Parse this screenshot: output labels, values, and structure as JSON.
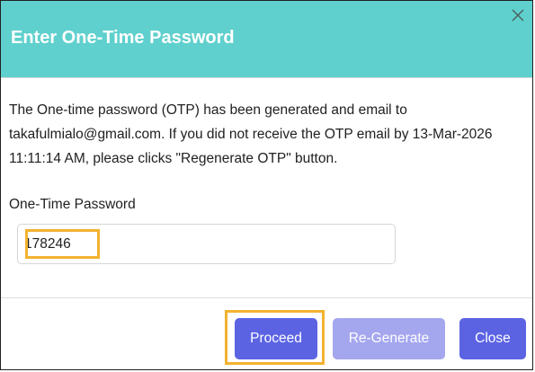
{
  "dialog": {
    "title": "Enter One-Time Password",
    "close_icon": "close-icon",
    "message": "The One-time password (OTP) has been generated and email to takafulmialo@gmail.com. If you did not receive the OTP email by 13-Mar-2026 11:11:14 AM, please clicks \"Regenerate OTP\" button.",
    "otp_label": "One-Time Password",
    "otp_value": "178246",
    "buttons": {
      "proceed": "Proceed",
      "regenerate": "Re-Generate",
      "close": "Close"
    }
  },
  "colors": {
    "header": "#5fd0cd",
    "primary_button": "#5b63e3",
    "disabled_button": "#a4a6ee",
    "highlight": "#f2b230"
  }
}
